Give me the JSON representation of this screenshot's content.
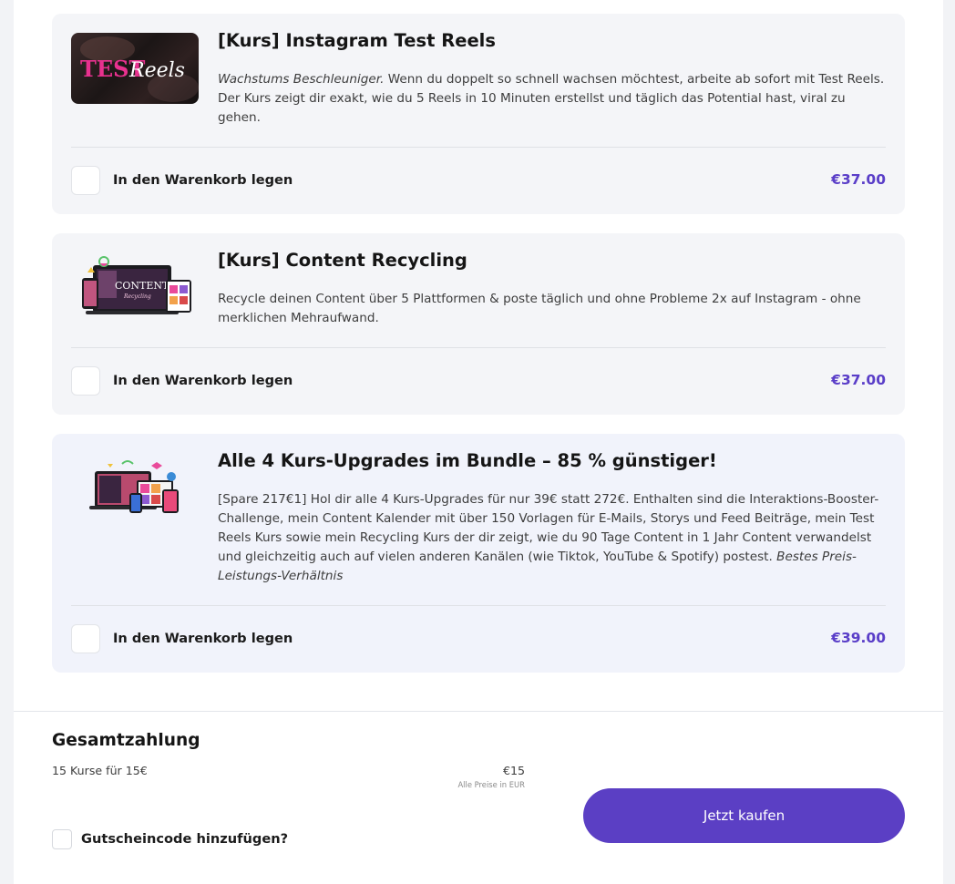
{
  "colors": {
    "accent": "#5b3fc4",
    "price": "#5a3ec8",
    "card_background": "#f4f5f8",
    "bundle_card_background": "#f1f3fb"
  },
  "products": [
    {
      "title": "[Kurs] Instagram Test Reels",
      "description_emphasis": "Wachstums Beschleuniger.",
      "description": " Wenn du doppelt so schnell wachsen möchtest, arbeite ab sofort mit Test Reels. Der Kurs zeigt dir exakt, wie du 5 Reels in 10 Minuten erstellst und täglich das Potential hast, viral zu gehen.",
      "thumbnail_text_1": "TEST",
      "thumbnail_text_2": "Reels",
      "cart_label": "In den Warenkorb legen",
      "price": "€37.00"
    },
    {
      "title": "[Kurs] Content Recycling",
      "description": "Recycle deinen Content über 5 Plattformen & poste täglich und ohne Probleme 2x auf Instagram - ohne merklichen Mehraufwand.",
      "thumbnail_text_1": "CONTENT",
      "thumbnail_text_2": "Recycling",
      "cart_label": "In den Warenkorb legen",
      "price": "€37.00"
    },
    {
      "title": "Alle 4 Kurs-Upgrades im Bundle – 85 % günstiger!",
      "description": "[Spare 217€1] Hol dir alle 4 Kurs-Upgrades für nur 39€ statt 272€. Enthalten sind die Interaktions-Booster-Challenge, mein Content Kalender mit über 150 Vorlagen für E-Mails, Storys und Feed Beiträge, mein Test Reels Kurs sowie mein Recycling Kurs der dir zeigt, wie du 90 Tage Content in 1 Jahr Content verwandelst und gleichzeitig auch auf vielen anderen Kanälen (wie Tiktok, YouTube & Spotify) postest. ",
      "description_emphasis": "Bestes Preis-Leistungs-Verhältnis",
      "cart_label": "In den Warenkorb legen",
      "price": "€39.00"
    }
  ],
  "summary": {
    "title": "Gesamtzahlung",
    "description": "15 Kurse für 15€",
    "price": "€15",
    "note": "Alle Preise in EUR",
    "coupon_label": "Gutscheincode hinzufügen?",
    "buy_label": "Jetzt kaufen"
  }
}
